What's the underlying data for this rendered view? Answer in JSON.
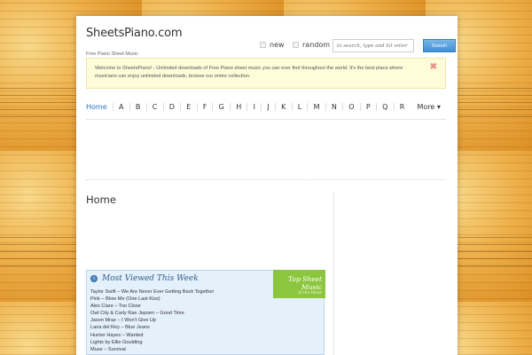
{
  "header": {
    "site_title": "SheetsPiano.com",
    "tagline": "Free Piano Sheet Music",
    "new_label": "new",
    "random_label": "random",
    "search_placeholder": "to search, type and hit enter",
    "search_button": "Search"
  },
  "notice": {
    "text": "Welcome to SheetsPiano! - Unlimited downloads of Free Piano sheet music you can ever find throughout the world. It's the best place where musicians can enjoy unlimited downloads, browse our entire collection.",
    "close_icon": "close-x"
  },
  "nav": {
    "items": [
      "Home",
      "A",
      "B",
      "C",
      "D",
      "E",
      "F",
      "G",
      "H",
      "I",
      "J",
      "K",
      "L",
      "M",
      "N",
      "O",
      "P",
      "Q",
      "R"
    ],
    "more_label": "More ▾"
  },
  "main": {
    "page_title": "Home"
  },
  "most_viewed": {
    "title": "Most Viewed This Week",
    "items": [
      "Taylor Swift – We Are Never Ever Getting Back Together",
      "Pink – Blow Me (One Last Kiss)",
      "Alex Clare – Too Close",
      "Owl City & Carly Rae Jepsen – Good Time",
      "Jason Mraz – I Won't Give Up",
      "Lana del Rey – Blue Jeans",
      "Hunter Hayes – Wanted",
      "Lights by Ellie Goulding",
      "Muse – Survival"
    ]
  },
  "top_sheet": {
    "line1": "Top Sheet Music",
    "line2": "of the Week",
    "color": "#8cc63f"
  },
  "colors": {
    "accent_blue": "#2a76c6",
    "background_gold": "#e9a23a"
  }
}
